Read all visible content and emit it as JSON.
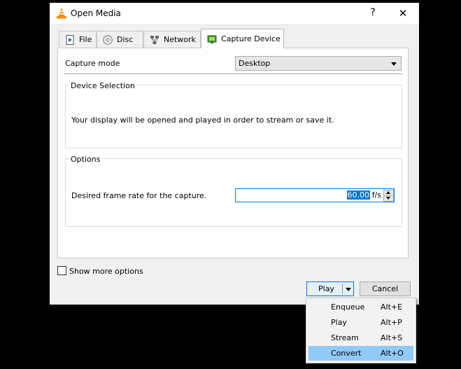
{
  "window": {
    "title": "Open Media",
    "help": "?",
    "close": "✕"
  },
  "tabs": [
    {
      "label": "File",
      "icon": "file-icon"
    },
    {
      "label": "Disc",
      "icon": "disc-icon"
    },
    {
      "label": "Network",
      "icon": "network-icon"
    },
    {
      "label": "Capture Device",
      "icon": "capture-device-icon",
      "active": true
    }
  ],
  "capture": {
    "mode_label": "Capture mode",
    "mode_value": "Desktop"
  },
  "device_selection": {
    "title": "Device Selection",
    "text": "Your display will be opened and played in order to stream or save it."
  },
  "options": {
    "title": "Options",
    "frame_rate_label": "Desired frame rate for the capture.",
    "frame_rate_value": "60.00",
    "frame_rate_unit": "f/s"
  },
  "show_more": "Show more options",
  "buttons": {
    "play": "Play",
    "cancel": "Cancel"
  },
  "menu": [
    {
      "label": "Enqueue",
      "shortcut": "Alt+E"
    },
    {
      "label": "Play",
      "shortcut": "Alt+P"
    },
    {
      "label": "Stream",
      "shortcut": "Alt+S"
    },
    {
      "label": "Convert",
      "shortcut": "Alt+O",
      "highlighted": true
    }
  ],
  "colors": {
    "accent": "#0078d7",
    "menu_highlight": "#91c9f7",
    "vlc_orange": "#f28c00"
  }
}
